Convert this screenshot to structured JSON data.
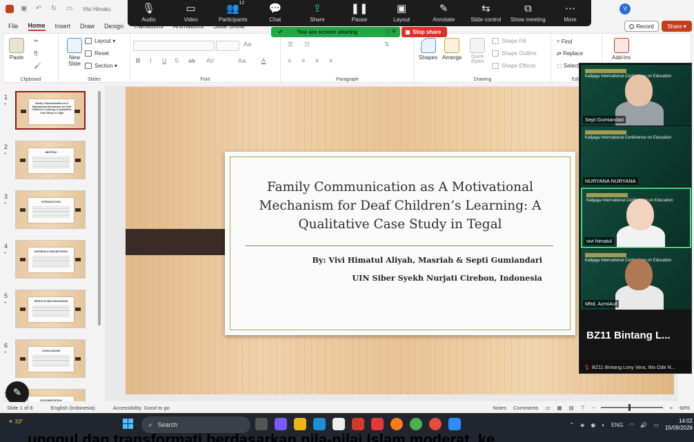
{
  "titlebar": {
    "doc_title": "Vivi Himatu",
    "user_initial": "V"
  },
  "zoom_toolbar": {
    "items": [
      {
        "label": "Audio",
        "glyph": "🎙",
        "caret": true
      },
      {
        "label": "Video",
        "glyph": "▭",
        "caret": true
      },
      {
        "label": "Participants",
        "glyph": "👥",
        "badge": "12"
      },
      {
        "label": "Chat",
        "glyph": "💬",
        "caret": true
      },
      {
        "label": "Share",
        "glyph": "⇪"
      },
      {
        "label": "Pause",
        "glyph": "❚❚"
      },
      {
        "label": "Layout",
        "glyph": "▣"
      },
      {
        "label": "Annotate",
        "glyph": "✎"
      },
      {
        "label": "Slide control",
        "glyph": "⇆"
      },
      {
        "label": "Show meeting",
        "glyph": "⧉"
      },
      {
        "label": "More",
        "glyph": "⋯"
      }
    ],
    "share_banner": "You are screen sharing",
    "stop_share": "Stop share"
  },
  "menu": {
    "tabs": [
      "File",
      "Home",
      "Insert",
      "Draw",
      "Design",
      "Transitions",
      "Animations",
      "Slide Show"
    ],
    "active": "Home",
    "record": "Record",
    "share": "Share"
  },
  "ribbon": {
    "clipboard": {
      "paste": "Paste",
      "label": "Clipboard"
    },
    "slides": {
      "new_slide": "New Slide",
      "layout": "Layout",
      "reset": "Reset",
      "section": "Section",
      "label": "Slides"
    },
    "font": {
      "label": "Font",
      "bold": "B",
      "italic": "I",
      "underline": "U",
      "strike": "S",
      "abc": "ab",
      "shadow": "AV",
      "aa": "Aa",
      "color_a": "A"
    },
    "paragraph": {
      "label": "Paragraph"
    },
    "drawing": {
      "shapes": "Shapes",
      "arrange": "Arrange",
      "quick_styles": "Quick Styles",
      "shape_fill": "Shape Fill",
      "shape_outline": "Shape Outline",
      "shape_effects": "Shape Effects",
      "label": "Drawing"
    },
    "editing": {
      "find": "Find",
      "replace": "Replace",
      "select": "Select",
      "label": "Editi"
    },
    "addins": {
      "label": "Add-ins"
    }
  },
  "thumbnails": [
    {
      "num": "1",
      "title": "Family Communication as A Motivational Mechanism for Deaf Children's Learning: A Qualitative Case Study in Tegal",
      "active": true
    },
    {
      "num": "2",
      "title": "ABSTRAC",
      "active": false
    },
    {
      "num": "3",
      "title": "INTRODUCTION",
      "active": false
    },
    {
      "num": "4",
      "title": "MATERIALS AND METHODS",
      "active": false
    },
    {
      "num": "5",
      "title": "RESULTS AND DISCUSSION",
      "active": false
    },
    {
      "num": "6",
      "title": "CONCLUSIONS",
      "active": false
    },
    {
      "num": "7",
      "title": "DOCUMENTATION",
      "active": false
    }
  ],
  "slide": {
    "title": "Family Communication as A Motivational Mechanism for Deaf Children’s Learning: A Qualitative Case Study in Tegal",
    "authors": "By: Vivi Himatul Aliyah, Masriah & Septi Gumiandari",
    "affiliation": "UIN Siber Syekh Nurjati Cirebon, Indonesia"
  },
  "videos": {
    "tiles": [
      {
        "name": "Sept  Gumiandari",
        "active": false,
        "conf_text": "Kalijaga International Conference on Education"
      },
      {
        "name": "NURYANA NURYANA",
        "active": false,
        "conf_text": "Kalijaga International Conference on Education"
      },
      {
        "name": "vivi himatul",
        "active": true,
        "conf_text": "Kalijaga International Conference on Education"
      },
      {
        "name": "Mhd. AzmiAuf",
        "active": false,
        "conf_text": "Kalijaga International Conference on Education"
      }
    ],
    "big_name": "BZ11  Bintang  L...",
    "footer": "BZ11 Bintang Lony Vera, Wa Ode N..."
  },
  "statusbar": {
    "slide_of": "Slide 1 of 8",
    "language": "English (Indonesia)",
    "accessibility": "Accessibility: Good to go",
    "notes": "Notes",
    "comments": "Comments",
    "zoom": "68%"
  },
  "taskbar": {
    "weather": "33°",
    "search": "Search",
    "lang": "ENG",
    "time": "14:02",
    "date": "15/09/2026"
  },
  "underlay_text": "unggul dan transformati berdasarkan nila-nilai Islam moderat, ke",
  "colors": {
    "accent": "#c43e1c",
    "zoom_green": "#22a745",
    "stop_red": "#e0302a",
    "active_speaker": "#3ddc84"
  }
}
